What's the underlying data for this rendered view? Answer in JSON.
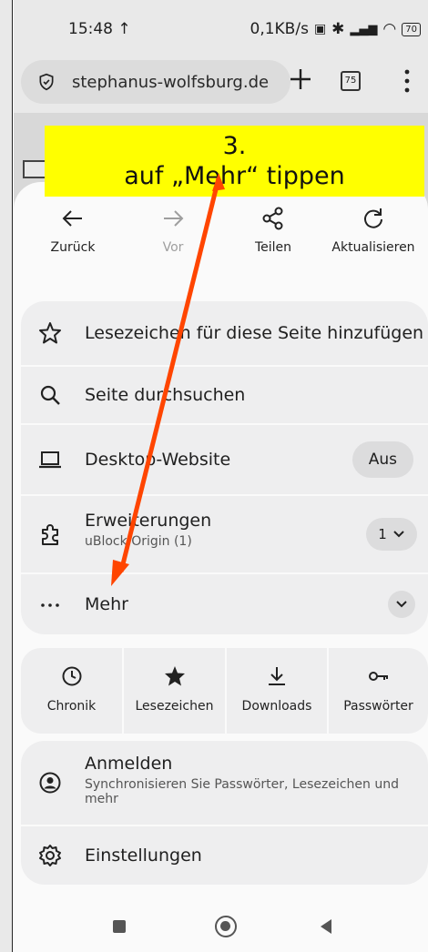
{
  "status_bar": {
    "time": "15:48",
    "network_speed": "0,1KB/s",
    "battery": "70"
  },
  "browser": {
    "url": "stephanus-wolfsburg.de",
    "tab_count": "75"
  },
  "nav": {
    "back": "Zurück",
    "forward": "Vor",
    "share": "Teilen",
    "reload": "Aktualisieren"
  },
  "menu": {
    "bookmark_add": "Lesezeichen für diese Seite hinzufügen",
    "find_in_page": "Seite durchsuchen",
    "desktop_site": "Desktop-Website",
    "desktop_site_state": "Aus",
    "extensions": "Erweiterungen",
    "extensions_sub": "uBlock Origin (1)",
    "extensions_count": "1",
    "more": "Mehr"
  },
  "quick": {
    "history": "Chronik",
    "bookmarks": "Lesezeichen",
    "downloads": "Downloads",
    "passwords": "Passwörter"
  },
  "account": {
    "sign_in": "Anmelden",
    "sign_in_sub": "Synchronisieren Sie Passwörter, Lesezeichen und mehr",
    "settings": "Einstellungen"
  },
  "annotation": {
    "line1": "3.",
    "line2": "auf „Mehr“ tippen",
    "color": "#ffff00",
    "arrow_color": "#ff4500"
  }
}
